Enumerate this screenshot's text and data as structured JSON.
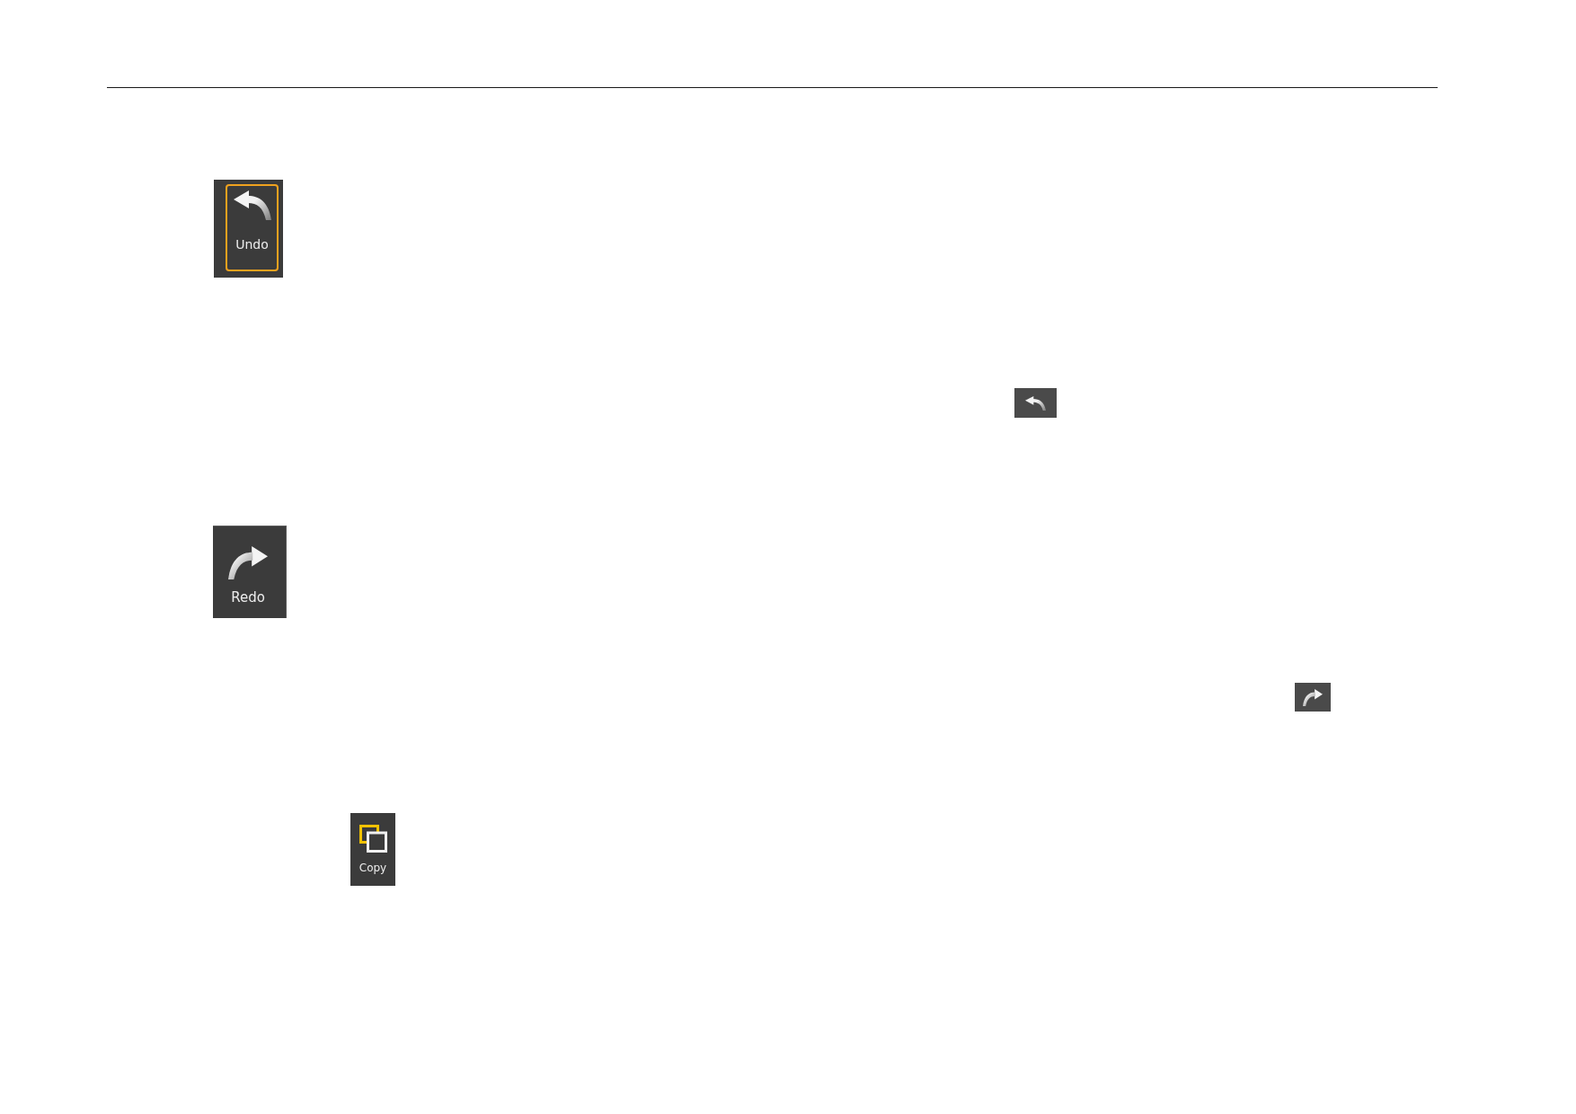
{
  "figures": [
    {
      "kind": "undo",
      "label": "Undo",
      "highlighted": true
    },
    {
      "kind": "undo_compact",
      "highlighted": false
    },
    {
      "kind": "redo",
      "label": "Redo",
      "highlighted": false
    },
    {
      "kind": "redo_compact",
      "highlighted": false
    },
    {
      "kind": "copy",
      "label": "Copy",
      "highlighted": false
    }
  ]
}
